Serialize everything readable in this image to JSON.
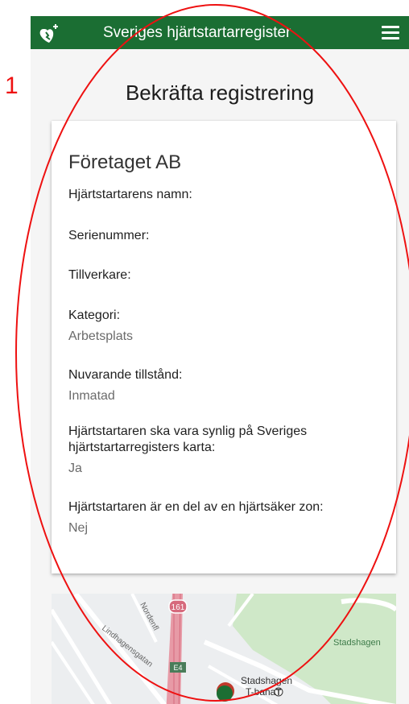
{
  "annotation": {
    "number": "1"
  },
  "header": {
    "title": "Sveriges hjärtstartarregister",
    "logo_icon": "heart-defibrillator-icon",
    "menu_icon": "hamburger-menu-icon",
    "bar_color": "#1b6e33"
  },
  "page": {
    "title": "Bekräfta registrering"
  },
  "card": {
    "company": "Företaget AB",
    "fields": [
      {
        "label": "Hjärtstartarens namn:",
        "value": ""
      },
      {
        "label": "Serienummer:",
        "value": ""
      },
      {
        "label": "Tillverkare:",
        "value": ""
      },
      {
        "label": "Kategori:",
        "value": "Arbetsplats"
      },
      {
        "label": "Nuvarande tillstånd:",
        "value": "Inmatad"
      },
      {
        "label": "Hjärtstartaren ska vara synlig på Sveriges hjärtstartarregisters karta:",
        "value": "Ja"
      },
      {
        "label": "Hjärtstartaren är en del av en hjärtsäker zon:",
        "value": "Nej"
      }
    ]
  },
  "map": {
    "labels": {
      "street1": "Lindhagensgatan",
      "street2": "Nordenfl",
      "road_shield_1": "161",
      "road_shield_2": "E4",
      "area": "Stadshagen",
      "station_line1": "Stadshagen",
      "station_line2": "T-bana"
    },
    "marker_colors": [
      "#c0392b",
      "#1b6e33"
    ]
  }
}
